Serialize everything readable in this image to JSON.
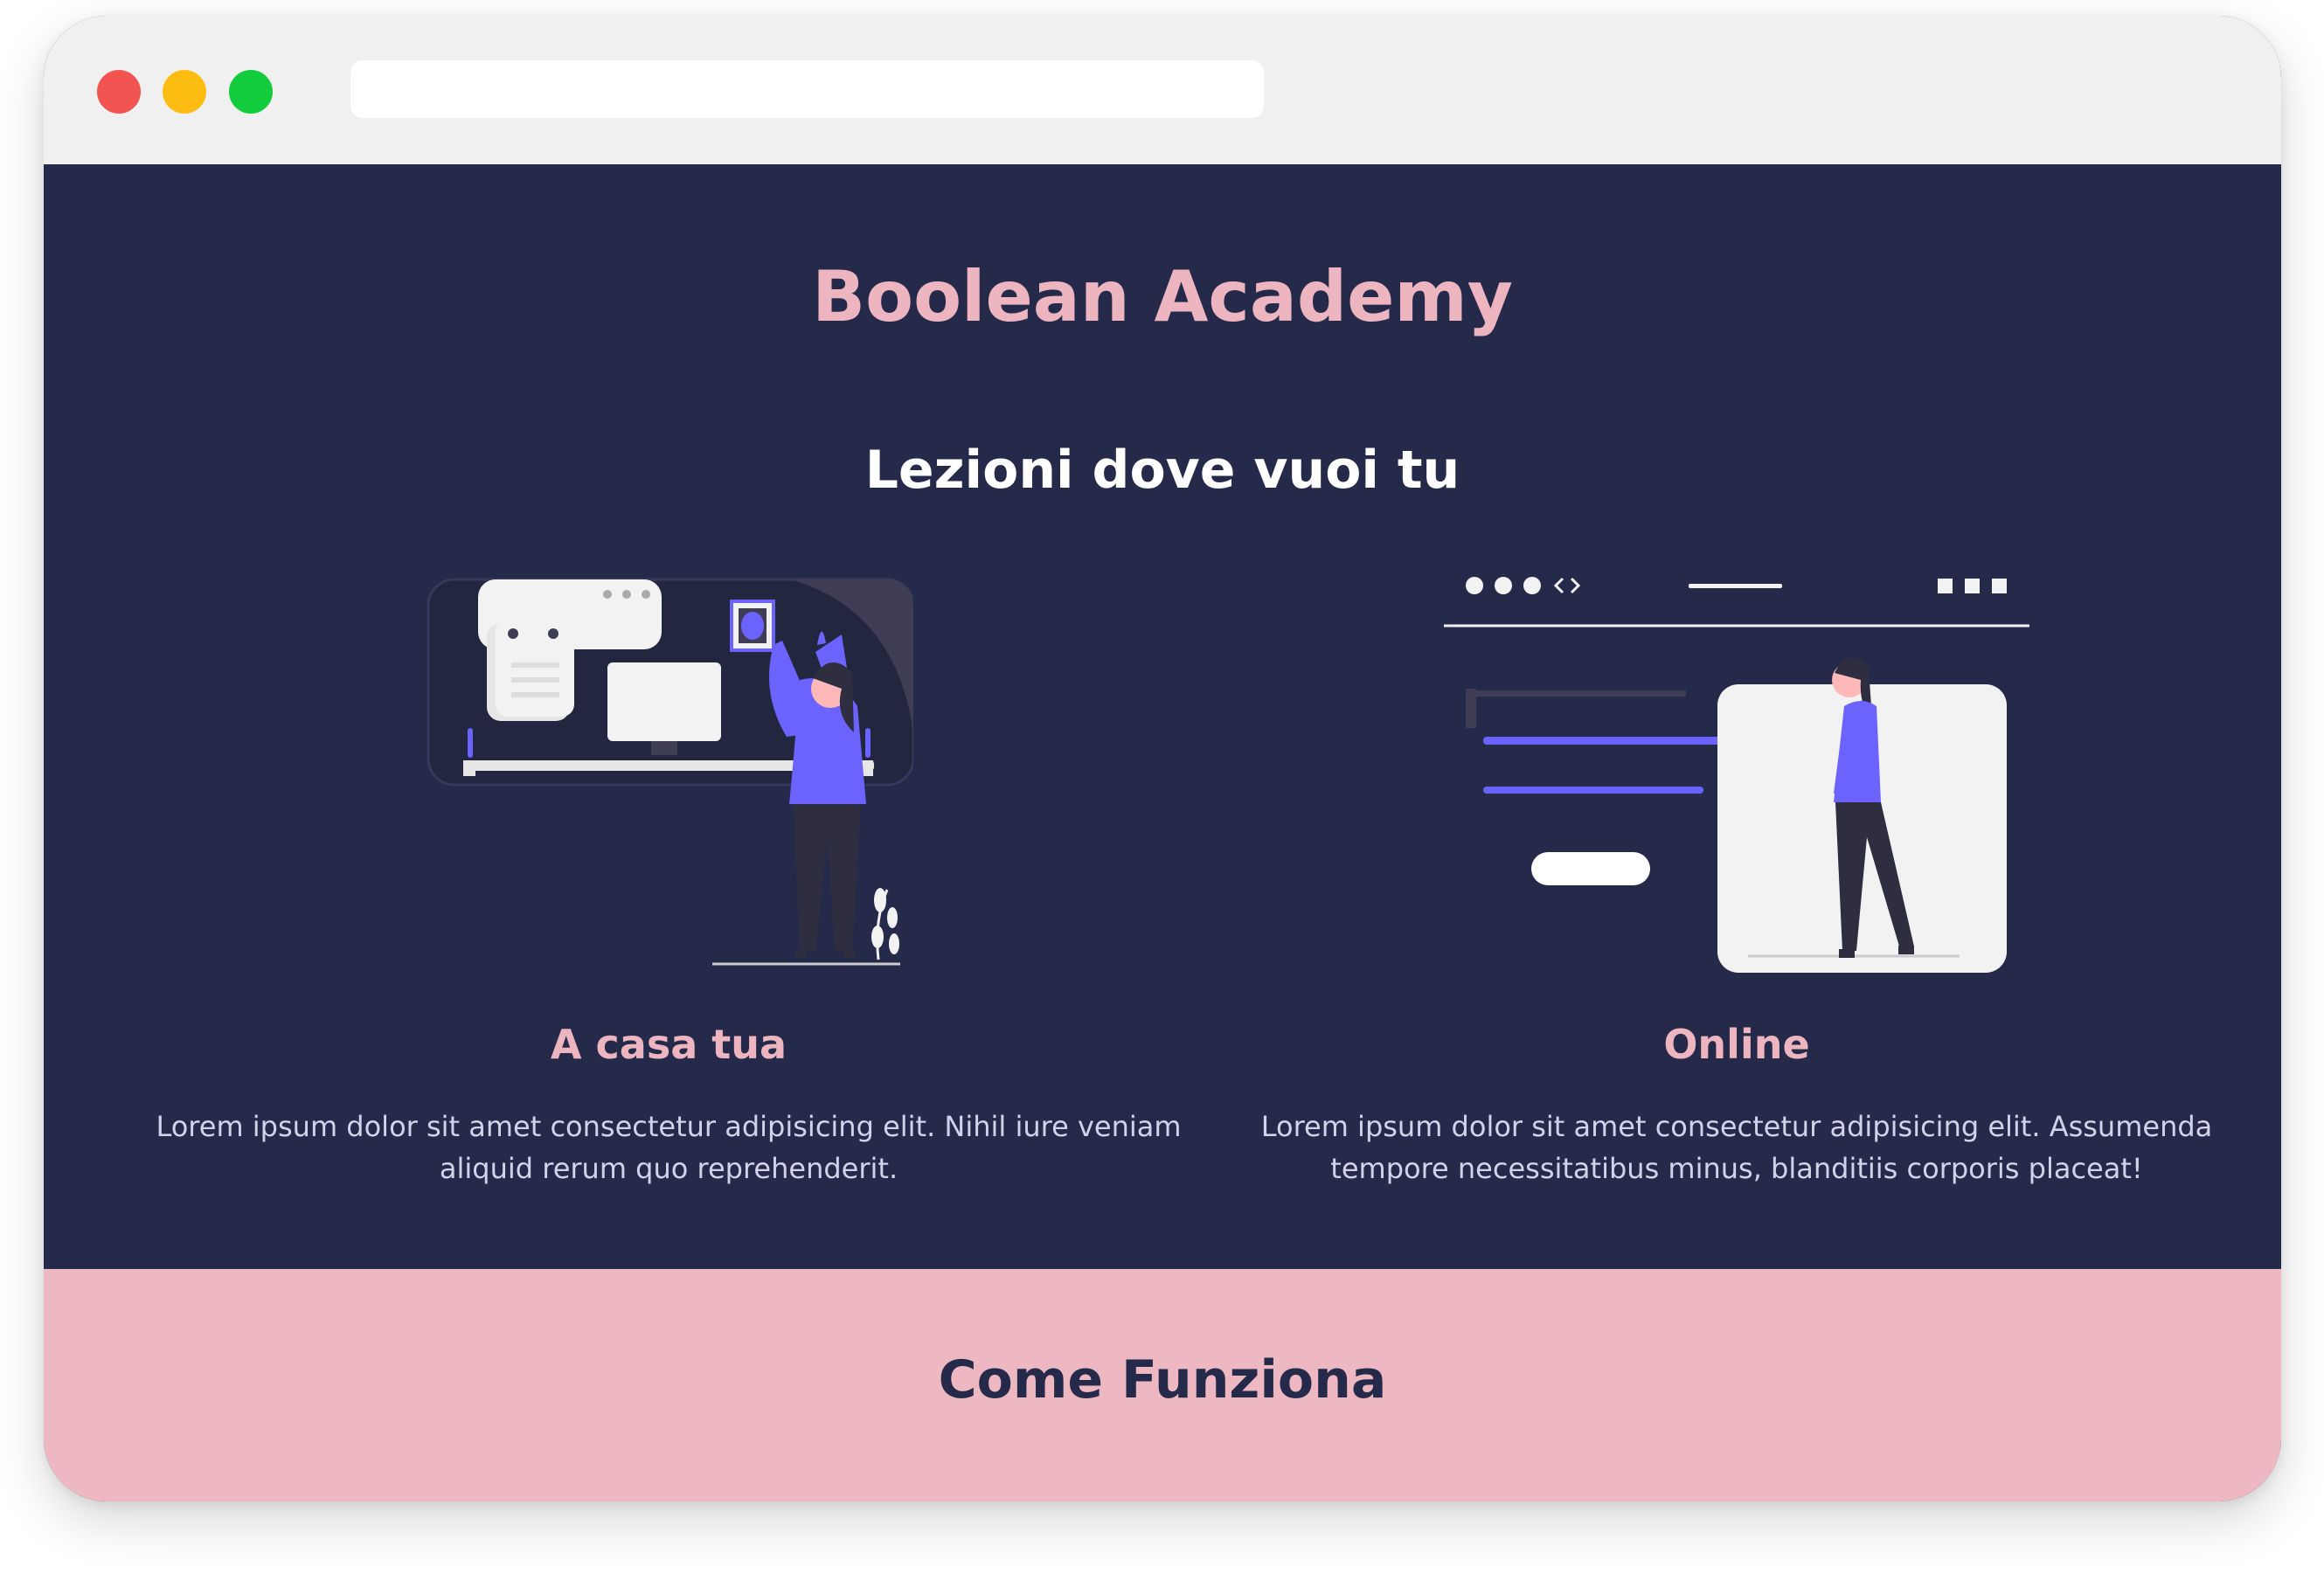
{
  "hero": {
    "brand": "Boolean Academy",
    "subtitle": "Lezioni dove vuoi tu",
    "cards": [
      {
        "title": "A casa tua",
        "text": "Lorem ipsum dolor sit amet consectetur adipisicing elit. Nihil iure veniam aliquid rerum quo reprehenderit.",
        "illustration": "woman-hanging-pictures-illustration"
      },
      {
        "title": "Online",
        "text": "Lorem ipsum dolor sit amet consectetur adipisicing elit. Assumenda tempore necessitatibus minus, blanditiis corporis placeat!",
        "illustration": "woman-online-browser-illustration"
      }
    ]
  },
  "section_how": {
    "title": "Come Funziona"
  },
  "colors": {
    "navy": "#262a4a",
    "pink": "#edb8c1",
    "pink_text": "#edb5bf",
    "accent_purple": "#6c63ff",
    "chrome": "#f0f0f0"
  }
}
